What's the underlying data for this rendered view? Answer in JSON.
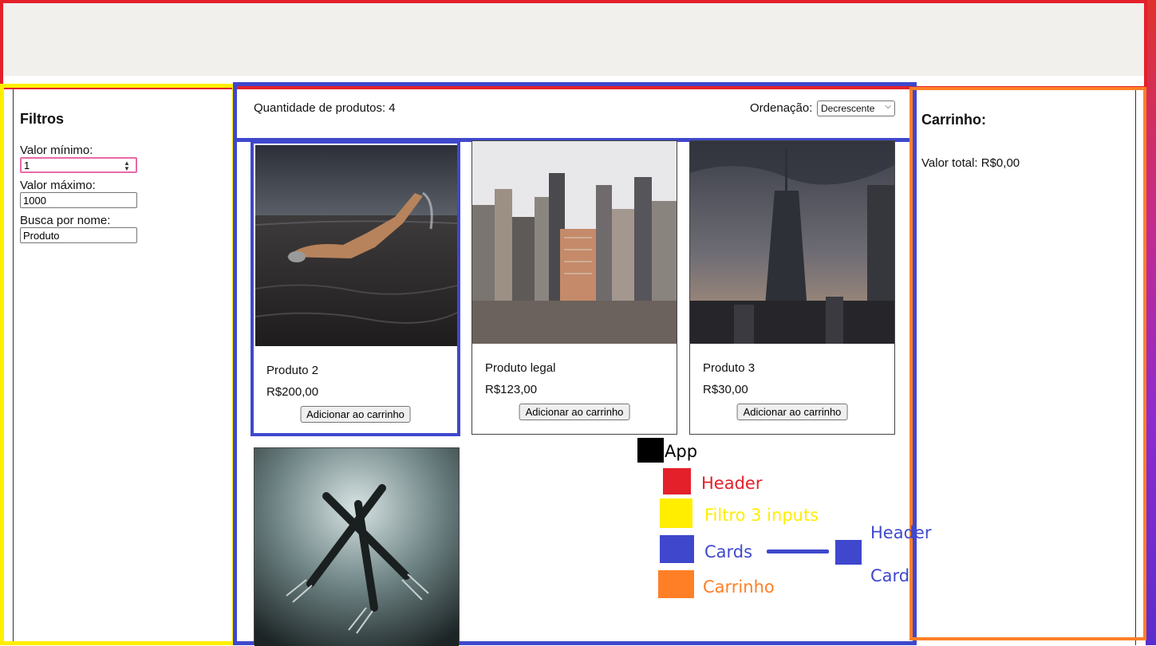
{
  "filters": {
    "title": "Filtros",
    "min_label": "Valor mínimo:",
    "min_value": "1",
    "max_label": "Valor máximo:",
    "max_value": "1000",
    "search_label": "Busca por nome:",
    "search_value": "Produto"
  },
  "products_header": {
    "count_text": "Quantidade de produtos: 4",
    "sort_label": "Ordenação:",
    "sort_selected": "Decrescente"
  },
  "products": [
    {
      "name": "Produto 2",
      "price": "R$200,00",
      "button": "Adicionar ao carrinho",
      "image": "swimmer-photo"
    },
    {
      "name": "Produto legal",
      "price": "R$123,00",
      "button": "Adicionar ao carrinho",
      "image": "city-skyline-photo"
    },
    {
      "name": "Produto 3",
      "price": "R$30,00",
      "button": "Adicionar ao carrinho",
      "image": "tower-photo"
    },
    {
      "image": "forks-photo"
    }
  ],
  "cart": {
    "title": "Carrinho:",
    "total_text": "Valor total: R$0,00"
  },
  "legend": {
    "app": "App",
    "header": "Header",
    "filter": "Filtro 3 inputs",
    "cards": "Cards",
    "sub_header": "Header",
    "sub_card": "Card",
    "cart": "Carrinho"
  },
  "colors": {
    "header": "#e4202a",
    "filter": "#ffee00",
    "cards": "#3f48cc",
    "cart": "#ff7f27",
    "app": "#000000"
  }
}
